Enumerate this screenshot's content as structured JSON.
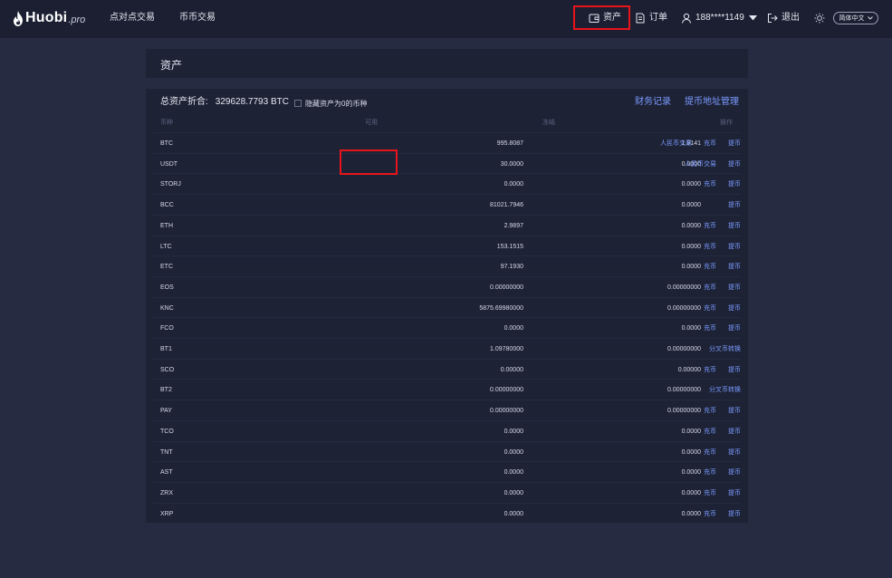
{
  "header": {
    "logo_text": "Huobi",
    "logo_suffix": ".pro",
    "nav": [
      "点对点交易",
      "币币交易"
    ],
    "assets_label": "资产",
    "orders_label": "订单",
    "user_label": "188****1149",
    "logout_label": "退出",
    "language_label": "简体中文"
  },
  "page": {
    "title": "资产",
    "total_label": "总资产折合:",
    "total_value": "329628.7793 BTC",
    "hide_label": "隐藏资产为0的币种",
    "finance_link": "财务记录",
    "address_link": "提币地址管理"
  },
  "table": {
    "headers": {
      "symbol": "币种",
      "available": "可用",
      "frozen": "冻结",
      "ops": "操作"
    },
    "rows": [
      {
        "symbol": "BTC",
        "available": "995.8087",
        "frozen": "1.9141",
        "ops": [
          "人民币交易",
          "充币",
          "提币"
        ]
      },
      {
        "symbol": "USDT",
        "available": "30.0000",
        "frozen": "0.0000",
        "ops": [
          "人民币交易",
          "提币"
        ]
      },
      {
        "symbol": "STORJ",
        "available": "0.0000",
        "frozen": "0.0000",
        "ops": [
          "充币",
          "提币"
        ]
      },
      {
        "symbol": "BCC",
        "available": "81021.7946",
        "frozen": "0.0000",
        "ops": [
          "提币"
        ]
      },
      {
        "symbol": "ETH",
        "available": "2.9897",
        "frozen": "0.0000",
        "ops": [
          "充币",
          "提币"
        ]
      },
      {
        "symbol": "LTC",
        "available": "153.1515",
        "frozen": "0.0000",
        "ops": [
          "充币",
          "提币"
        ]
      },
      {
        "symbol": "ETC",
        "available": "97.1930",
        "frozen": "0.0000",
        "ops": [
          "充币",
          "提币"
        ]
      },
      {
        "symbol": "EOS",
        "available": "0.00000000",
        "frozen": "0.00000000",
        "ops": [
          "充币",
          "提币"
        ]
      },
      {
        "symbol": "KNC",
        "available": "5875.69980000",
        "frozen": "0.00000000",
        "ops": [
          "充币",
          "提币"
        ]
      },
      {
        "symbol": "FCO",
        "available": "0.0000",
        "frozen": "0.0000",
        "ops": [
          "充币",
          "提币"
        ]
      },
      {
        "symbol": "BT1",
        "available": "1.09780000",
        "frozen": "0.00000000",
        "ops": [
          "分叉币转换"
        ]
      },
      {
        "symbol": "SCO",
        "available": "0.00000",
        "frozen": "0.00000",
        "ops": [
          "充币",
          "提币"
        ]
      },
      {
        "symbol": "BT2",
        "available": "0.00000000",
        "frozen": "0.00000000",
        "ops": [
          "分叉币转换"
        ]
      },
      {
        "symbol": "PAY",
        "available": "0.00000000",
        "frozen": "0.00000000",
        "ops": [
          "充币",
          "提币"
        ]
      },
      {
        "symbol": "TCO",
        "available": "0.0000",
        "frozen": "0.0000",
        "ops": [
          "充币",
          "提币"
        ]
      },
      {
        "symbol": "TNT",
        "available": "0.0000",
        "frozen": "0.0000",
        "ops": [
          "充币",
          "提币"
        ]
      },
      {
        "symbol": "AST",
        "available": "0.0000",
        "frozen": "0.0000",
        "ops": [
          "充币",
          "提币"
        ]
      },
      {
        "symbol": "ZRX",
        "available": "0.0000",
        "frozen": "0.0000",
        "ops": [
          "充币",
          "提币"
        ]
      },
      {
        "symbol": "XRP",
        "available": "0.0000",
        "frozen": "0.0000",
        "ops": [
          "充币",
          "提币"
        ]
      }
    ]
  },
  "colors": {
    "background": "#262b41",
    "panel": "#1d2235",
    "topbar": "#1b1f31",
    "link": "#7b9bff",
    "highlight": "#e8141c"
  },
  "icons": [
    "flame-logo-icon",
    "wallet-icon",
    "document-icon",
    "user-icon",
    "caret-down-icon",
    "logout-icon",
    "sun-icon",
    "chevron-down-icon"
  ]
}
